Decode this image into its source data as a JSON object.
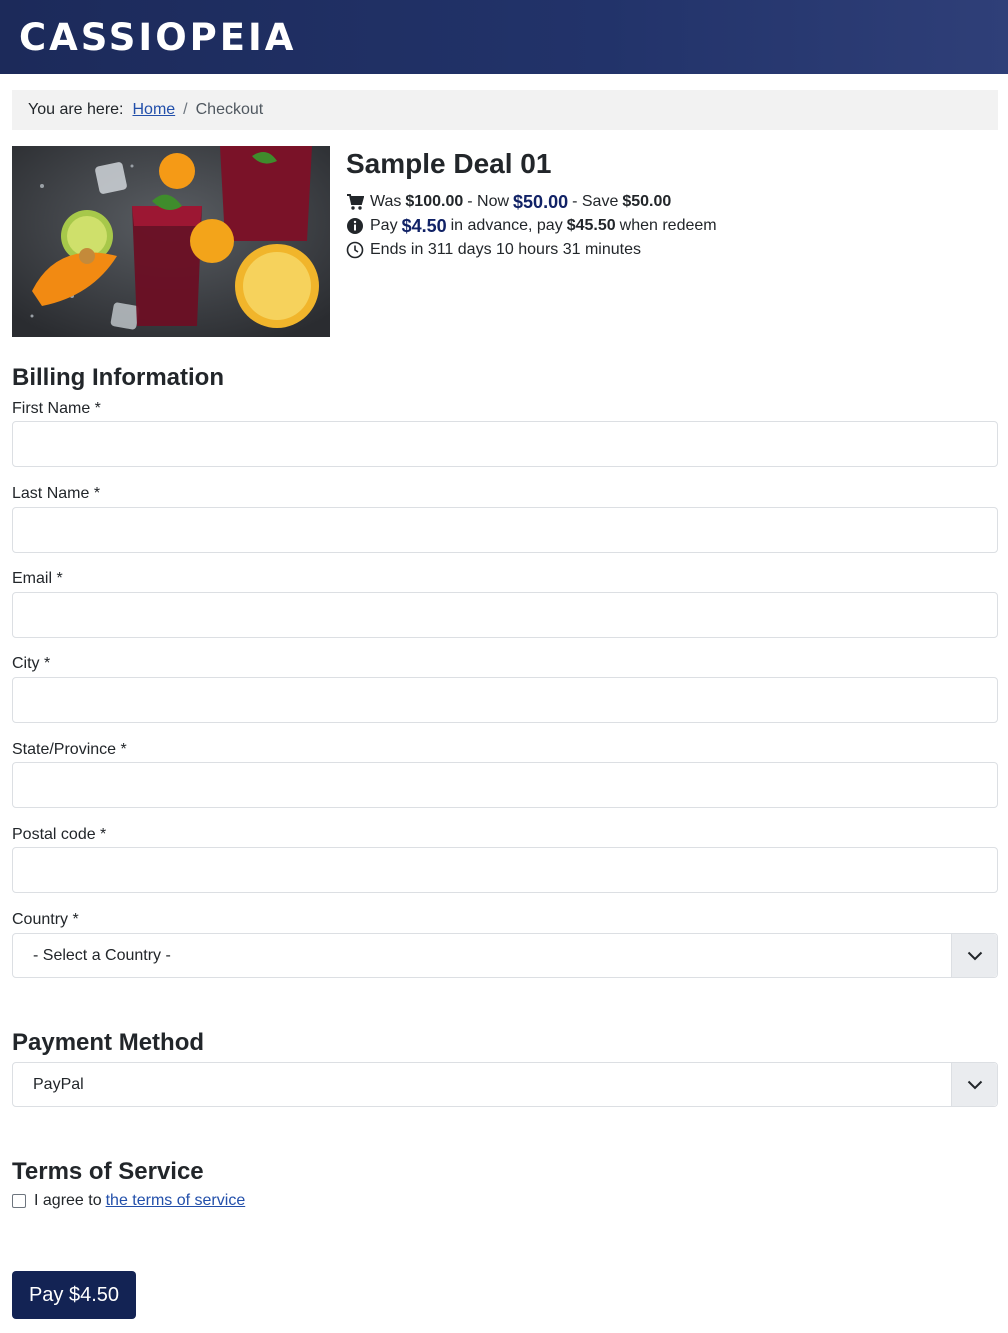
{
  "header": {
    "brand": "CASSIOPEIA"
  },
  "breadcrumb": {
    "prefix": "You are here:",
    "home": "Home",
    "separator": "/",
    "current": "Checkout"
  },
  "deal": {
    "title": "Sample Deal 01",
    "was_label": "Was",
    "was_price": "$100.00",
    "now_label": "- Now",
    "now_price": "$50.00",
    "save_label": "- Save",
    "save_price": "$50.00",
    "pay_label": "Pay",
    "pay_advance": "$4.50",
    "advance_text": "in advance, pay",
    "pay_redeem": "$45.50",
    "redeem_text": "when redeem",
    "ends_text": "Ends in 311 days 10 hours 31 minutes"
  },
  "billing": {
    "title": "Billing Information",
    "first_name_label": "First Name *",
    "last_name_label": "Last Name *",
    "email_label": "Email *",
    "city_label": "City *",
    "state_label": "State/Province *",
    "postal_label": "Postal code *",
    "country_label": "Country *",
    "country_value": "- Select a Country -"
  },
  "payment": {
    "title": "Payment Method",
    "method_value": "PayPal"
  },
  "terms": {
    "title": "Terms of Service",
    "agree_text": "I agree to",
    "link_text": "the terms of service",
    "checked": false
  },
  "submit": {
    "label": "Pay $4.50"
  },
  "colors": {
    "header": "#1c2a5a",
    "link": "#224faa",
    "price": "#112266",
    "button": "#132354"
  }
}
